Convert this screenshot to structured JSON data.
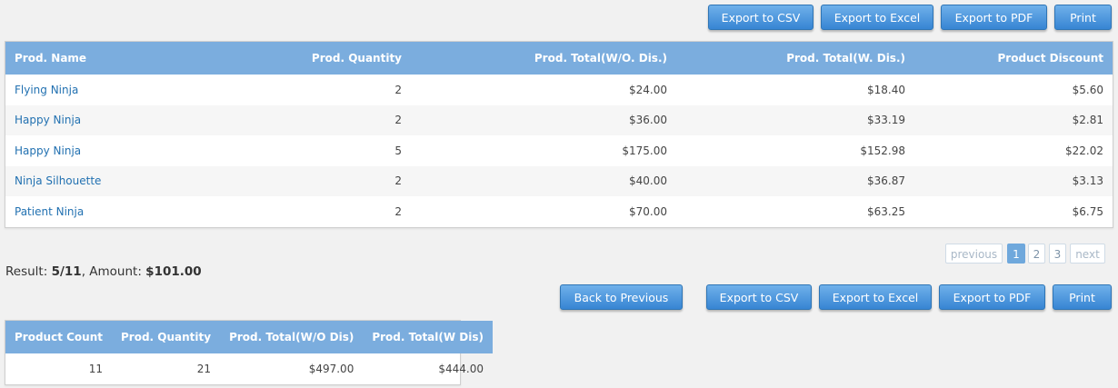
{
  "toolbar_top": {
    "export_csv": "Export to CSV",
    "export_excel": "Export to Excel",
    "export_pdf": "Export to PDF",
    "print": "Print"
  },
  "products_table": {
    "headers": [
      "Prod. Name",
      "Prod. Quantity",
      "Prod. Total(W/O. Dis.)",
      "Prod. Total(W. Dis.)",
      "Product Discount"
    ],
    "rows": [
      {
        "name": "Flying Ninja",
        "qty": "2",
        "total_wo": "$24.00",
        "total_w": "$18.40",
        "discount": "$5.60"
      },
      {
        "name": "Happy Ninja",
        "qty": "2",
        "total_wo": "$36.00",
        "total_w": "$33.19",
        "discount": "$2.81"
      },
      {
        "name": "Happy Ninja",
        "qty": "5",
        "total_wo": "$175.00",
        "total_w": "$152.98",
        "discount": "$22.02"
      },
      {
        "name": "Ninja Silhouette",
        "qty": "2",
        "total_wo": "$40.00",
        "total_w": "$36.87",
        "discount": "$3.13"
      },
      {
        "name": "Patient Ninja",
        "qty": "2",
        "total_wo": "$70.00",
        "total_w": "$63.25",
        "discount": "$6.75"
      }
    ]
  },
  "pagination": {
    "previous": "previous",
    "pages": [
      "1",
      "2",
      "3"
    ],
    "current": "1",
    "next": "next"
  },
  "result": {
    "result_label": "Result:",
    "result_value": "5/11",
    "amount_label": ", Amount:",
    "amount_value": "$101.00"
  },
  "toolbar_bottom": {
    "back": "Back to Previous",
    "export_csv": "Export to CSV",
    "export_excel": "Export to Excel",
    "export_pdf": "Export to PDF",
    "print": "Print"
  },
  "summary_table": {
    "headers": [
      "Product Count",
      "Prod. Quantity",
      "Prod. Total(W/O Dis)",
      "Prod. Total(W Dis)"
    ],
    "row": {
      "count": "11",
      "qty": "21",
      "total_wo": "$497.00",
      "total_w": "$444.00"
    }
  },
  "colors": {
    "header_bg": "#7badde",
    "button_top": "#6fb0ea",
    "button_bottom": "#3785d3",
    "link": "#2271b1"
  }
}
